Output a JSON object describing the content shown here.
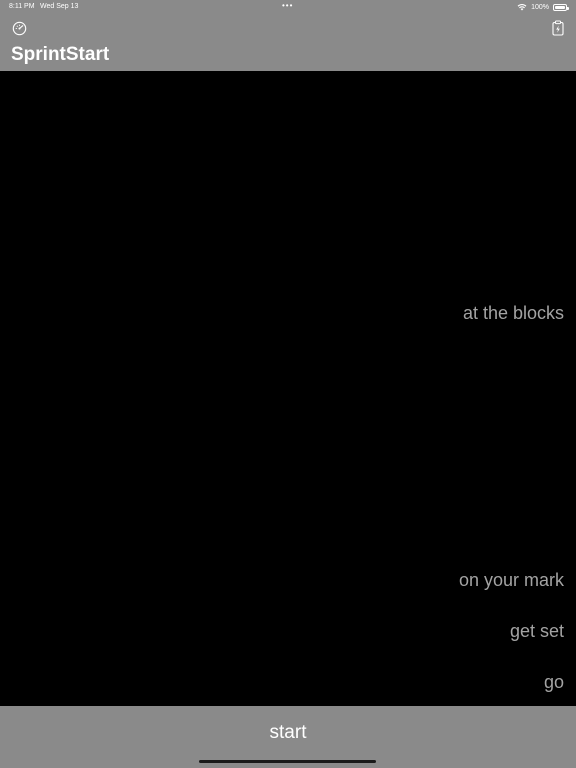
{
  "status_bar": {
    "time": "8:11 PM",
    "date": "Wed Sep 13",
    "dots": "•••",
    "battery_percent": "100%"
  },
  "nav": {
    "title": "SprintStart",
    "settings_icon": "gauge-icon",
    "clipboard_icon": "clipboard-bolt-icon"
  },
  "stages": {
    "at_the_blocks": "at the blocks",
    "on_your_mark": "on your mark",
    "get_set": "get set",
    "go": "go"
  },
  "start_button": {
    "label": "start"
  },
  "colors": {
    "bar_background": "#8a8a8a",
    "content_background": "#000000",
    "stage_text": "#a3a3a3",
    "title_text": "#ffffff"
  }
}
